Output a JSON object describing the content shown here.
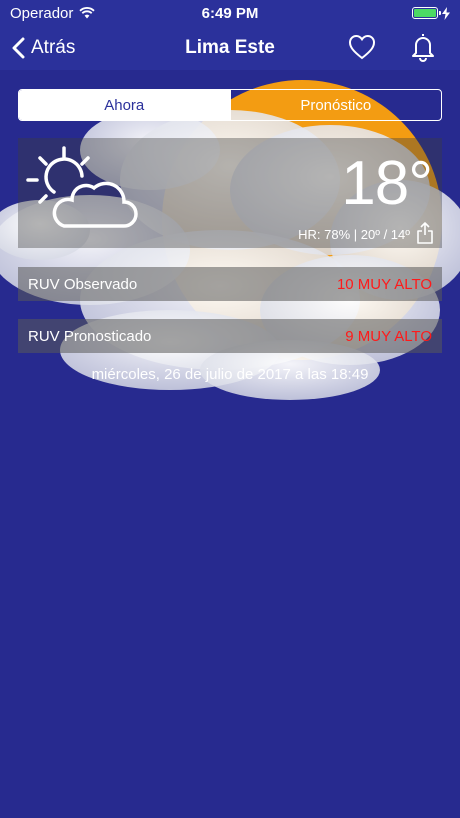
{
  "status_bar": {
    "carrier": "Operador",
    "time": "6:49 PM"
  },
  "nav": {
    "back_label": "Atrás",
    "title": "Lima Este"
  },
  "tabs": [
    {
      "label": "Ahora",
      "active": true
    },
    {
      "label": "Pronóstico",
      "active": false
    }
  ],
  "weather": {
    "condition_icon": "partly-cloudy-icon",
    "temperature": "18°",
    "details": "HR: 78% | 20º / 14º"
  },
  "ruv": {
    "observed_label": "RUV Observado",
    "observed_value": "10 MUY ALTO",
    "forecast_label": "RUV Pronosticado",
    "forecast_value": "9 MUY ALTO"
  },
  "date_text": "miércoles, 26 de julio de 2017 a las 18:49",
  "colors": {
    "background": "#272a8f",
    "nav_bar": "#2b319b",
    "ruv_alert": "#ff1a1a",
    "sun": "#f39c12"
  }
}
